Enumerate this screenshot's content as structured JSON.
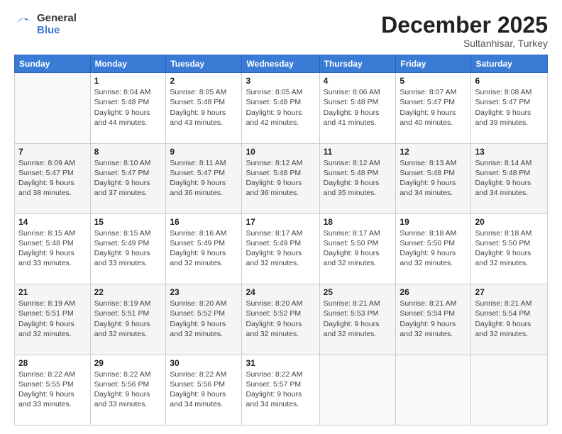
{
  "logo": {
    "general": "General",
    "blue": "Blue"
  },
  "header": {
    "month": "December 2025",
    "location": "Sultanhisar, Turkey"
  },
  "weekdays": [
    "Sunday",
    "Monday",
    "Tuesday",
    "Wednesday",
    "Thursday",
    "Friday",
    "Saturday"
  ],
  "weeks": [
    [
      {
        "day": "",
        "info": ""
      },
      {
        "day": "1",
        "info": "Sunrise: 8:04 AM\nSunset: 5:48 PM\nDaylight: 9 hours\nand 44 minutes."
      },
      {
        "day": "2",
        "info": "Sunrise: 8:05 AM\nSunset: 5:48 PM\nDaylight: 9 hours\nand 43 minutes."
      },
      {
        "day": "3",
        "info": "Sunrise: 8:05 AM\nSunset: 5:48 PM\nDaylight: 9 hours\nand 42 minutes."
      },
      {
        "day": "4",
        "info": "Sunrise: 8:06 AM\nSunset: 5:48 PM\nDaylight: 9 hours\nand 41 minutes."
      },
      {
        "day": "5",
        "info": "Sunrise: 8:07 AM\nSunset: 5:47 PM\nDaylight: 9 hours\nand 40 minutes."
      },
      {
        "day": "6",
        "info": "Sunrise: 8:08 AM\nSunset: 5:47 PM\nDaylight: 9 hours\nand 39 minutes."
      }
    ],
    [
      {
        "day": "7",
        "info": "Sunrise: 8:09 AM\nSunset: 5:47 PM\nDaylight: 9 hours\nand 38 minutes."
      },
      {
        "day": "8",
        "info": "Sunrise: 8:10 AM\nSunset: 5:47 PM\nDaylight: 9 hours\nand 37 minutes."
      },
      {
        "day": "9",
        "info": "Sunrise: 8:11 AM\nSunset: 5:47 PM\nDaylight: 9 hours\nand 36 minutes."
      },
      {
        "day": "10",
        "info": "Sunrise: 8:12 AM\nSunset: 5:48 PM\nDaylight: 9 hours\nand 36 minutes."
      },
      {
        "day": "11",
        "info": "Sunrise: 8:12 AM\nSunset: 5:48 PM\nDaylight: 9 hours\nand 35 minutes."
      },
      {
        "day": "12",
        "info": "Sunrise: 8:13 AM\nSunset: 5:48 PM\nDaylight: 9 hours\nand 34 minutes."
      },
      {
        "day": "13",
        "info": "Sunrise: 8:14 AM\nSunset: 5:48 PM\nDaylight: 9 hours\nand 34 minutes."
      }
    ],
    [
      {
        "day": "14",
        "info": "Sunrise: 8:15 AM\nSunset: 5:48 PM\nDaylight: 9 hours\nand 33 minutes."
      },
      {
        "day": "15",
        "info": "Sunrise: 8:15 AM\nSunset: 5:49 PM\nDaylight: 9 hours\nand 33 minutes."
      },
      {
        "day": "16",
        "info": "Sunrise: 8:16 AM\nSunset: 5:49 PM\nDaylight: 9 hours\nand 32 minutes."
      },
      {
        "day": "17",
        "info": "Sunrise: 8:17 AM\nSunset: 5:49 PM\nDaylight: 9 hours\nand 32 minutes."
      },
      {
        "day": "18",
        "info": "Sunrise: 8:17 AM\nSunset: 5:50 PM\nDaylight: 9 hours\nand 32 minutes."
      },
      {
        "day": "19",
        "info": "Sunrise: 8:18 AM\nSunset: 5:50 PM\nDaylight: 9 hours\nand 32 minutes."
      },
      {
        "day": "20",
        "info": "Sunrise: 8:18 AM\nSunset: 5:50 PM\nDaylight: 9 hours\nand 32 minutes."
      }
    ],
    [
      {
        "day": "21",
        "info": "Sunrise: 8:19 AM\nSunset: 5:51 PM\nDaylight: 9 hours\nand 32 minutes."
      },
      {
        "day": "22",
        "info": "Sunrise: 8:19 AM\nSunset: 5:51 PM\nDaylight: 9 hours\nand 32 minutes."
      },
      {
        "day": "23",
        "info": "Sunrise: 8:20 AM\nSunset: 5:52 PM\nDaylight: 9 hours\nand 32 minutes."
      },
      {
        "day": "24",
        "info": "Sunrise: 8:20 AM\nSunset: 5:52 PM\nDaylight: 9 hours\nand 32 minutes."
      },
      {
        "day": "25",
        "info": "Sunrise: 8:21 AM\nSunset: 5:53 PM\nDaylight: 9 hours\nand 32 minutes."
      },
      {
        "day": "26",
        "info": "Sunrise: 8:21 AM\nSunset: 5:54 PM\nDaylight: 9 hours\nand 32 minutes."
      },
      {
        "day": "27",
        "info": "Sunrise: 8:21 AM\nSunset: 5:54 PM\nDaylight: 9 hours\nand 32 minutes."
      }
    ],
    [
      {
        "day": "28",
        "info": "Sunrise: 8:22 AM\nSunset: 5:55 PM\nDaylight: 9 hours\nand 33 minutes."
      },
      {
        "day": "29",
        "info": "Sunrise: 8:22 AM\nSunset: 5:56 PM\nDaylight: 9 hours\nand 33 minutes."
      },
      {
        "day": "30",
        "info": "Sunrise: 8:22 AM\nSunset: 5:56 PM\nDaylight: 9 hours\nand 34 minutes."
      },
      {
        "day": "31",
        "info": "Sunrise: 8:22 AM\nSunset: 5:57 PM\nDaylight: 9 hours\nand 34 minutes."
      },
      {
        "day": "",
        "info": ""
      },
      {
        "day": "",
        "info": ""
      },
      {
        "day": "",
        "info": ""
      }
    ]
  ]
}
